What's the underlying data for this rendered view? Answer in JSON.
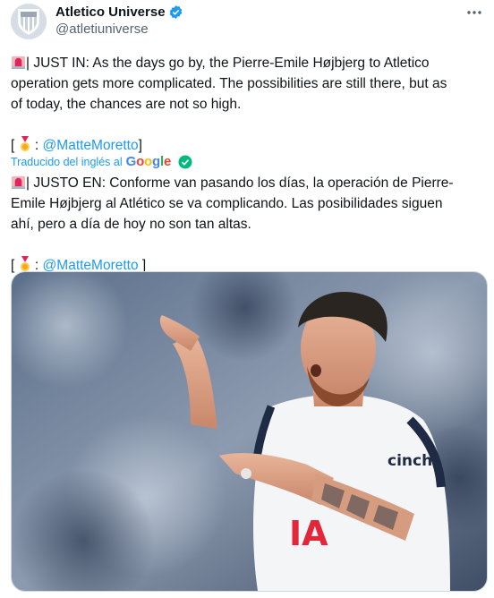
{
  "account": {
    "name": "Atletico Universe",
    "handle": "@atletiuniverse"
  },
  "original": {
    "line1": "| JUST IN: As the days go by, the Pierre-Emile Højbjerg to Atletico",
    "line2": "operation gets more complicated. The possibilities are still there, but as",
    "line3": "of today, the chances are not so high.",
    "credit_open": "[",
    "credit_colon": " : ",
    "credit_mention": "@MatteMoretto",
    "credit_close": "]"
  },
  "translation": {
    "label": "Traducido del inglés al",
    "provider": [
      "G",
      "o",
      "o",
      "g",
      "l",
      "e"
    ],
    "line1": "| JUSTO EN: Conforme van pasando los días, la operación de Pierre-",
    "line2": "Emile Højbjerg al Atlético se va complicando. Las posibilidades siguen",
    "line3": "ahí, pero a día de hoy no son tan altas.",
    "credit_open": "[",
    "credit_colon": " : ",
    "credit_mention": "@MatteMoretto",
    "credit_close": " ]"
  },
  "photo": {
    "shirt_sponsor": "cinch",
    "shirt_text": "IA"
  },
  "icons": [
    "atletico-crest-icon",
    "verified-badge-icon",
    "more-options-icon",
    "police-light-icon",
    "medal-icon",
    "translation-check-icon"
  ],
  "colors": {
    "accent": "#1d9bf0",
    "text": "#0f1419",
    "muted": "#536471",
    "verified": "#1d9bf0"
  }
}
